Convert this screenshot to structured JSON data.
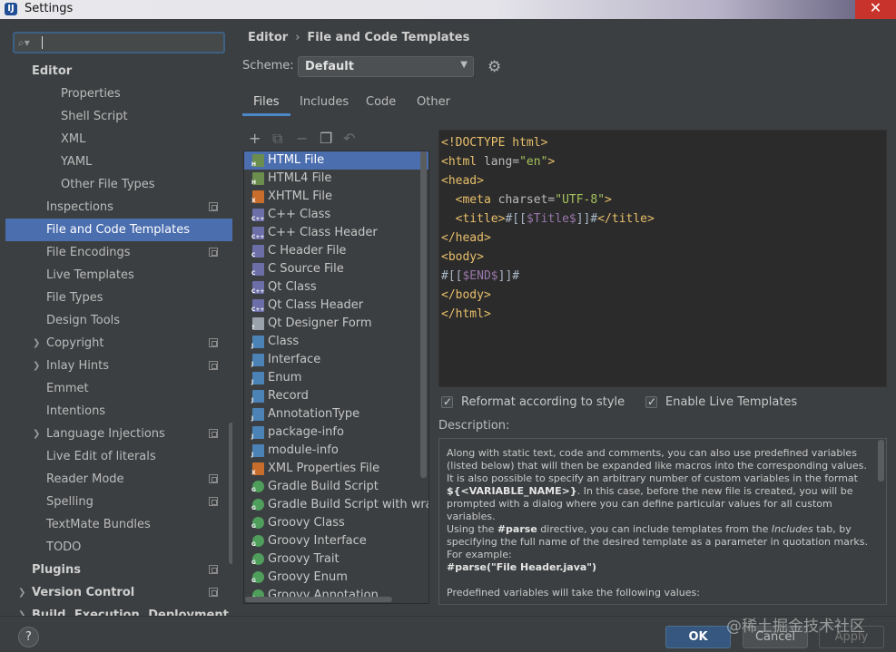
{
  "window": {
    "title": "Settings",
    "icon": "intellij-icon"
  },
  "search": {
    "value": ""
  },
  "tree": [
    {
      "label": "Editor",
      "level": 1,
      "bold": true,
      "arrow": "",
      "proj": false
    },
    {
      "label": "Properties",
      "level": 3,
      "bold": false,
      "arrow": "",
      "proj": false
    },
    {
      "label": "Shell Script",
      "level": 3,
      "bold": false,
      "arrow": "",
      "proj": false
    },
    {
      "label": "XML",
      "level": 3,
      "bold": false,
      "arrow": "",
      "proj": false
    },
    {
      "label": "YAML",
      "level": 3,
      "bold": false,
      "arrow": "",
      "proj": false
    },
    {
      "label": "Other File Types",
      "level": 3,
      "bold": false,
      "arrow": "",
      "proj": false
    },
    {
      "label": "Inspections",
      "level": 2,
      "bold": false,
      "arrow": "",
      "proj": true
    },
    {
      "label": "File and Code Templates",
      "level": 2,
      "bold": false,
      "arrow": "",
      "proj": false,
      "selected": true
    },
    {
      "label": "File Encodings",
      "level": 2,
      "bold": false,
      "arrow": "",
      "proj": true
    },
    {
      "label": "Live Templates",
      "level": 2,
      "bold": false,
      "arrow": "",
      "proj": false
    },
    {
      "label": "File Types",
      "level": 2,
      "bold": false,
      "arrow": "",
      "proj": false
    },
    {
      "label": "Design Tools",
      "level": 2,
      "bold": false,
      "arrow": "",
      "proj": false
    },
    {
      "label": "Copyright",
      "level": 2,
      "bold": false,
      "arrow": "›",
      "proj": true
    },
    {
      "label": "Inlay Hints",
      "level": 2,
      "bold": false,
      "arrow": "›",
      "proj": true
    },
    {
      "label": "Emmet",
      "level": 2,
      "bold": false,
      "arrow": "",
      "proj": false
    },
    {
      "label": "Intentions",
      "level": 2,
      "bold": false,
      "arrow": "",
      "proj": false
    },
    {
      "label": "Language Injections",
      "level": 2,
      "bold": false,
      "arrow": "›",
      "proj": true
    },
    {
      "label": "Live Edit of literals",
      "level": 2,
      "bold": false,
      "arrow": "",
      "proj": false
    },
    {
      "label": "Reader Mode",
      "level": 2,
      "bold": false,
      "arrow": "",
      "proj": true
    },
    {
      "label": "Spelling",
      "level": 2,
      "bold": false,
      "arrow": "",
      "proj": true
    },
    {
      "label": "TextMate Bundles",
      "level": 2,
      "bold": false,
      "arrow": "",
      "proj": false
    },
    {
      "label": "TODO",
      "level": 2,
      "bold": false,
      "arrow": "",
      "proj": false
    },
    {
      "label": "Plugins",
      "level": 1,
      "bold": true,
      "arrow": "",
      "proj": true
    },
    {
      "label": "Version Control",
      "level": 1,
      "bold": true,
      "arrow": "›",
      "proj": true
    },
    {
      "label": "Build, Execution, Deployment",
      "level": 1,
      "bold": true,
      "arrow": "›",
      "proj": false
    }
  ],
  "breadcrumb": {
    "parent": "Editor",
    "separator": "›",
    "current": "File and Code Templates"
  },
  "scheme": {
    "label": "Scheme:",
    "value": "Default"
  },
  "tabs": [
    {
      "label": "Files",
      "active": true
    },
    {
      "label": "Includes",
      "active": false
    },
    {
      "label": "Code",
      "active": false
    },
    {
      "label": "Other",
      "active": false
    }
  ],
  "toolbar": {
    "add": "+",
    "copy": "⧉",
    "remove": "−",
    "duplicate": "❐",
    "reset": "↶"
  },
  "files": [
    {
      "name": "HTML File",
      "icon": "html-file-icon",
      "color": "#6b8e4e",
      "tag": "H",
      "selected": true
    },
    {
      "name": "HTML4 File",
      "icon": "html-file-icon",
      "color": "#6b8e4e",
      "tag": "H"
    },
    {
      "name": "XHTML File",
      "icon": "xhtml-file-icon",
      "color": "#c96d2d",
      "tag": "X"
    },
    {
      "name": "C++ Class",
      "icon": "cpp-class-icon",
      "color": "#6c6ea8",
      "tag": "C++"
    },
    {
      "name": "C++ Class Header",
      "icon": "cpp-header-icon",
      "color": "#6c6ea8",
      "tag": "C++"
    },
    {
      "name": "C Header File",
      "icon": "c-header-icon",
      "color": "#6c6ea8",
      "tag": "C"
    },
    {
      "name": "C Source File",
      "icon": "c-source-icon",
      "color": "#6c6ea8",
      "tag": "C"
    },
    {
      "name": "Qt Class",
      "icon": "qt-class-icon",
      "color": "#6c6ea8",
      "tag": "C++"
    },
    {
      "name": "Qt Class Header",
      "icon": "qt-header-icon",
      "color": "#6c6ea8",
      "tag": "C++"
    },
    {
      "name": "Qt Designer Form",
      "icon": "qt-form-icon",
      "color": "#9aa3ab",
      "tag": "?"
    },
    {
      "name": "Class",
      "icon": "java-class-icon",
      "color": "#4b83b6",
      "tag": "J"
    },
    {
      "name": "Interface",
      "icon": "java-interface-icon",
      "color": "#4b83b6",
      "tag": "J"
    },
    {
      "name": "Enum",
      "icon": "java-enum-icon",
      "color": "#4b83b6",
      "tag": "J"
    },
    {
      "name": "Record",
      "icon": "java-record-icon",
      "color": "#4b83b6",
      "tag": "J"
    },
    {
      "name": "AnnotationType",
      "icon": "java-annotation-icon",
      "color": "#4b83b6",
      "tag": "J"
    },
    {
      "name": "package-info",
      "icon": "java-file-icon",
      "color": "#4b83b6",
      "tag": "J"
    },
    {
      "name": "module-info",
      "icon": "java-file-icon",
      "color": "#4b83b6",
      "tag": "J"
    },
    {
      "name": "XML Properties File",
      "icon": "xml-properties-icon",
      "color": "#c96d2d",
      "tag": "X"
    },
    {
      "name": "Gradle Build Script",
      "icon": "groovy-icon",
      "color": "#4f9e5c",
      "tag": "G",
      "round": true
    },
    {
      "name": "Gradle Build Script with wrapp",
      "icon": "groovy-icon",
      "color": "#4f9e5c",
      "tag": "G",
      "round": true
    },
    {
      "name": "Groovy Class",
      "icon": "groovy-icon",
      "color": "#4f9e5c",
      "tag": "G",
      "round": true
    },
    {
      "name": "Groovy Interface",
      "icon": "groovy-icon",
      "color": "#4f9e5c",
      "tag": "G",
      "round": true
    },
    {
      "name": "Groovy Trait",
      "icon": "groovy-icon",
      "color": "#4f9e5c",
      "tag": "G",
      "round": true
    },
    {
      "name": "Groovy Enum",
      "icon": "groovy-icon",
      "color": "#4f9e5c",
      "tag": "G",
      "round": true
    },
    {
      "name": "Groovy Annotation",
      "icon": "groovy-icon",
      "color": "#4f9e5c",
      "tag": "G",
      "round": true
    }
  ],
  "editor": {
    "lines": [
      [
        {
          "t": "<!DOCTYPE ",
          "c": "c-tag"
        },
        {
          "t": "html",
          "c": "c-tag"
        },
        {
          "t": ">",
          "c": "c-tag"
        }
      ],
      [
        {
          "t": "<html ",
          "c": "c-tag"
        },
        {
          "t": "lang=",
          "c": "c-attr"
        },
        {
          "t": "\"en\"",
          "c": "c-str"
        },
        {
          "t": ">",
          "c": "c-tag"
        }
      ],
      [
        {
          "t": "<head>",
          "c": "c-tag"
        }
      ],
      [
        {
          "t": "  ",
          "c": "c-txt"
        },
        {
          "t": "<meta ",
          "c": "c-tag"
        },
        {
          "t": "charset=",
          "c": "c-attr"
        },
        {
          "t": "\"UTF-8\"",
          "c": "c-str"
        },
        {
          "t": ">",
          "c": "c-tag"
        }
      ],
      [
        {
          "t": "  ",
          "c": "c-txt"
        },
        {
          "t": "<title>",
          "c": "c-tag"
        },
        {
          "t": "#[[",
          "c": "c-txt"
        },
        {
          "t": "$Title$",
          "c": "c-var"
        },
        {
          "t": "]]#",
          "c": "c-txt"
        },
        {
          "t": "</title>",
          "c": "c-tag"
        }
      ],
      [
        {
          "t": "</head>",
          "c": "c-tag"
        }
      ],
      [
        {
          "t": "<body>",
          "c": "c-tag"
        }
      ],
      [
        {
          "t": "#[[",
          "c": "c-txt"
        },
        {
          "t": "$END$",
          "c": "c-var"
        },
        {
          "t": "]]#",
          "c": "c-txt"
        }
      ],
      [
        {
          "t": "</body>",
          "c": "c-tag"
        }
      ],
      [
        {
          "t": "</html>",
          "c": "c-tag"
        }
      ]
    ]
  },
  "options": {
    "reformat": {
      "label": "Reformat according to style",
      "checked": true
    },
    "live_templates": {
      "label": "Enable Live Templates",
      "checked": true
    }
  },
  "description": {
    "label": "Description:",
    "p1": "Along with static text, code and comments, you can also use predefined variables (listed below) that will then be expanded like macros into the corresponding values.",
    "p2a": "It is also possible to specify an arbitrary number of custom variables in the format ",
    "p2b": "${<VARIABLE_NAME>}",
    "p2c": ". In this case, before the new file is created, you will be prompted with a dialog where you can define particular values for all custom variables.",
    "p3a": "Using the ",
    "p3b": "#parse",
    "p3c": " directive, you can include templates from the ",
    "p3d": "Includes",
    "p3e": " tab, by specifying the full name of the desired template as a parameter in quotation marks. For example:",
    "p4": "#parse(\"File Header.java\")",
    "p5": "Predefined variables will take the following values:"
  },
  "buttons": {
    "help": "?",
    "ok": "OK",
    "cancel": "Cancel",
    "apply": "Apply"
  },
  "watermark": "@稀土掘金技术社区"
}
